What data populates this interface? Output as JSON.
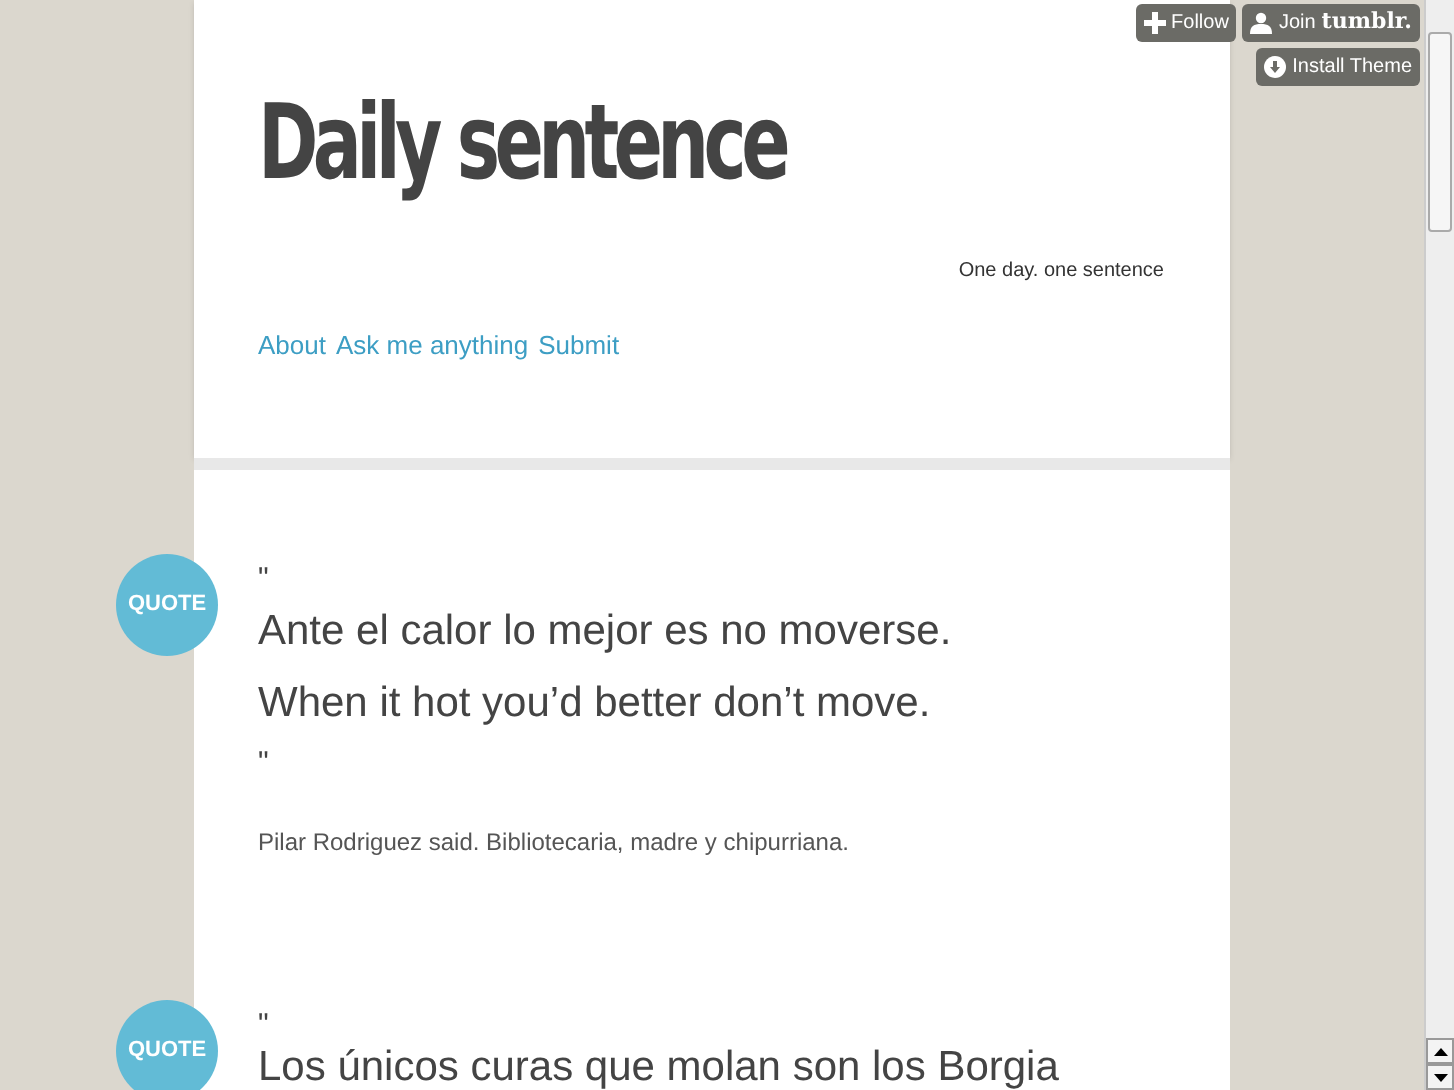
{
  "tumblr_bar": {
    "follow": "Follow",
    "join": "Join",
    "join_brand": "tumblr.",
    "install": "Install Theme"
  },
  "header": {
    "title": "Daily sentence",
    "tagline": "One day. one sentence",
    "nav": [
      "About",
      "Ask me anything",
      "Submit"
    ]
  },
  "posts": [
    {
      "badge": "QUOTE",
      "open_mark": "\"",
      "lines": [
        "Ante el calor lo mejor es no moverse.",
        "When it hot you’d better don’t move."
      ],
      "close_mark": "\"",
      "source": "Pilar Rodriguez said. Bibliotecaria, madre y chipurriana."
    },
    {
      "badge": "QUOTE",
      "open_mark": "\"",
      "lines": [
        "Los únicos curas que molan son los Borgia"
      ]
    }
  ]
}
